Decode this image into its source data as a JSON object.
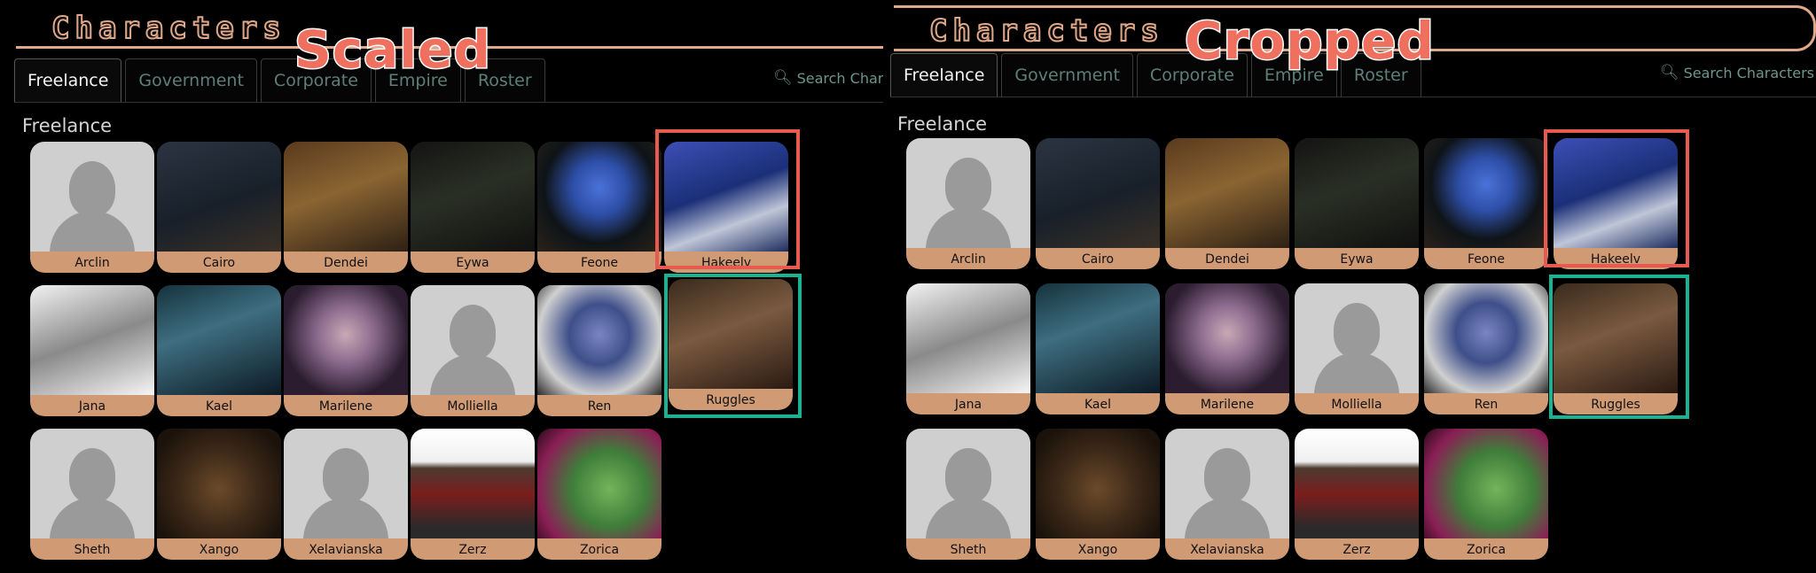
{
  "left": {
    "title": "Characters",
    "tabs": [
      "Freelance",
      "Government",
      "Corporate",
      "Empire",
      "Roster"
    ],
    "search_label": "Search Chara",
    "section": "Freelance",
    "overlay_label": "Scaled",
    "cards": [
      [
        "Arclin",
        "Cairo",
        "Dendei",
        "Eywa",
        "Feone",
        "Hakeelv"
      ],
      [
        "Jana",
        "Kael",
        "Marilene",
        "Molliella",
        "Ren",
        "Ruggles"
      ],
      [
        "Sheth",
        "Xango",
        "Xelavianska",
        "Zerz",
        "Zorica"
      ]
    ]
  },
  "right": {
    "title": "Characters",
    "tabs": [
      "Freelance",
      "Government",
      "Corporate",
      "Empire",
      "Roster"
    ],
    "search_label": "Search Characters",
    "section": "Freelance",
    "overlay_label": "Cropped",
    "cards": [
      [
        "Arclin",
        "Cairo",
        "Dendei",
        "Eywa",
        "Feone",
        "Hakeelv"
      ],
      [
        "Jana",
        "Kael",
        "Marilene",
        "Molliella",
        "Ren",
        "Ruggles"
      ],
      [
        "Sheth",
        "Xango",
        "Xelavianska",
        "Zerz",
        "Zorica"
      ]
    ]
  },
  "colors": {
    "accent": "#e0a888",
    "name_plate": "#d09a75",
    "highlight_red": "#e85a4f",
    "highlight_teal": "#19b394",
    "tab_text": "#5e7f78"
  },
  "icons": {
    "search": "search-icon"
  }
}
